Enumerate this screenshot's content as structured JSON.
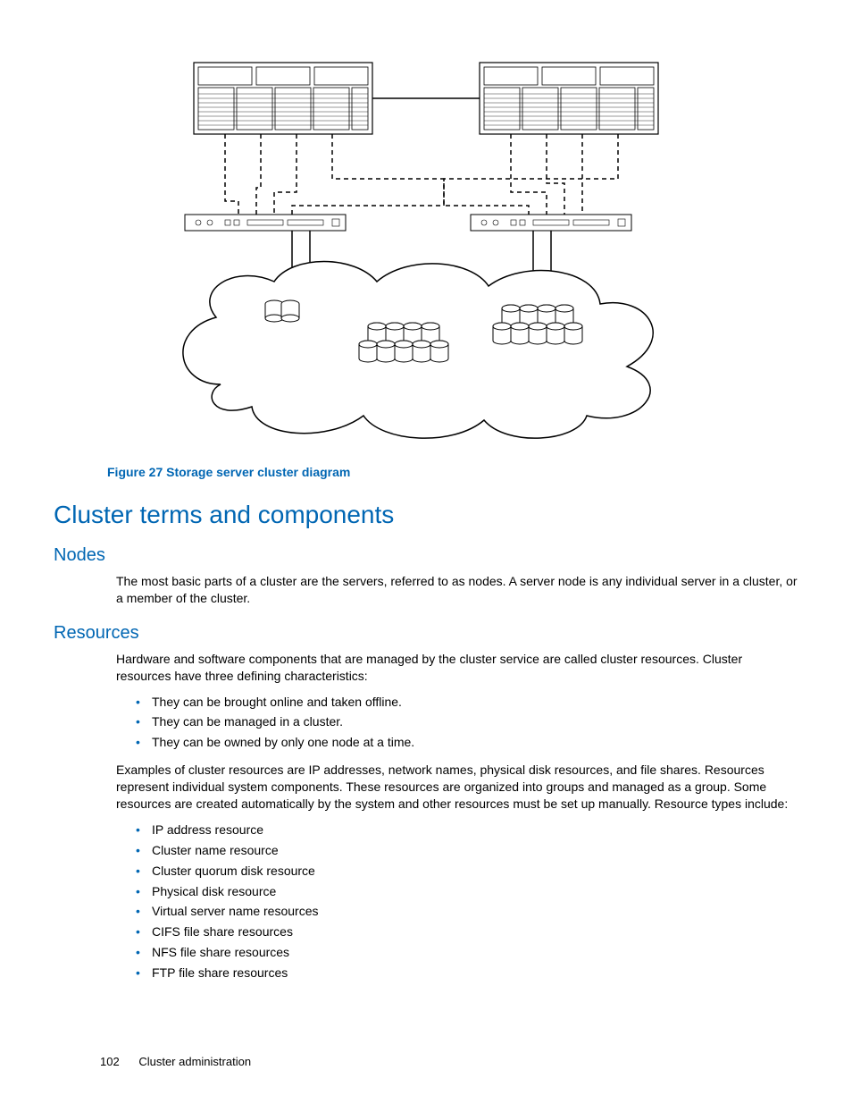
{
  "figure_caption": "Figure 27 Storage server cluster diagram",
  "section_title": "Cluster terms and components",
  "nodes": {
    "heading": "Nodes",
    "para": "The most basic parts of a cluster are the servers, referred to as nodes. A server node is any individual server in a cluster, or a member of the cluster."
  },
  "resources": {
    "heading": "Resources",
    "para1": "Hardware and software components that are managed by the cluster service are called cluster resources. Cluster resources have three defining characteristics:",
    "characteristics": [
      "They can be brought online and taken offline.",
      "They can be managed in a cluster.",
      "They can be owned by only one node at a time."
    ],
    "para2": "Examples of cluster resources are IP addresses, network names, physical disk resources, and file shares. Resources represent individual system components. These resources are organized into groups and managed as a group. Some resources are created automatically by the system and other resources must be set up manually. Resource types include:",
    "types": [
      "IP address resource",
      "Cluster name resource",
      "Cluster quorum disk resource",
      "Physical disk resource",
      "Virtual server name resources",
      "CIFS file share resources",
      "NFS file share resources",
      "FTP file share resources"
    ]
  },
  "footer": {
    "page": "102",
    "chapter": "Cluster administration"
  }
}
